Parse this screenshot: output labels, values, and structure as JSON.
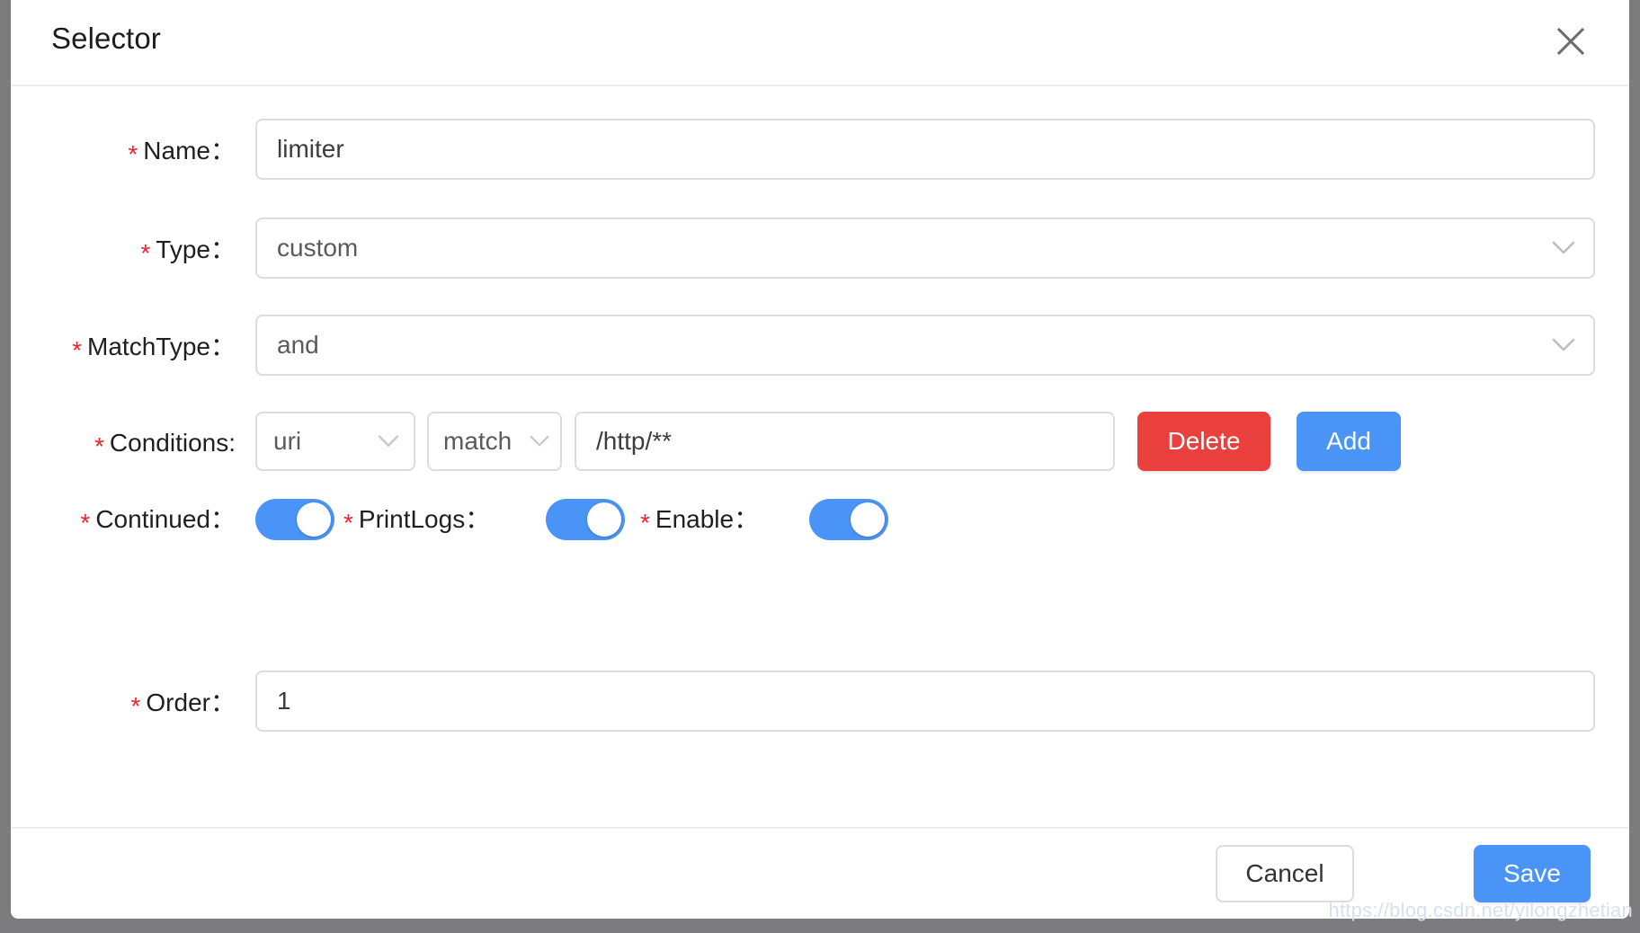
{
  "dialog": {
    "title": "Selector",
    "close_icon": "close-icon"
  },
  "form": {
    "name": {
      "label": "Name",
      "required_marker": "*",
      "colon": "：",
      "value": "limiter"
    },
    "type": {
      "label": "Type",
      "required_marker": "*",
      "colon": "：",
      "value": "custom",
      "dropdown_icon": "chevron-down-icon"
    },
    "match_type": {
      "label": "MatchType",
      "required_marker": "*",
      "colon": "：",
      "value": "and",
      "dropdown_icon": "chevron-down-icon"
    },
    "conditions": {
      "label": "Conditions:",
      "required_marker": "*",
      "rows": [
        {
          "param_type": "uri",
          "operator": "match",
          "value": "/http/**"
        }
      ],
      "delete_label": "Delete",
      "add_label": "Add"
    },
    "continued": {
      "label": "Continued",
      "required_marker": "*",
      "colon": "：",
      "checked": true
    },
    "print_logs": {
      "label": "PrintLogs",
      "required_marker": "*",
      "colon": "：",
      "checked": true
    },
    "enable": {
      "label": "Enable",
      "required_marker": "*",
      "colon": "：",
      "checked": true
    },
    "order": {
      "label": "Order",
      "required_marker": "*",
      "colon": "：",
      "value": "1"
    }
  },
  "footer": {
    "cancel_label": "Cancel",
    "save_label": "Save"
  },
  "watermark": {
    "text": "https://blog.csdn.net/yilongzhetian"
  },
  "colors": {
    "primary": "#4a94f8",
    "danger": "#e9403d",
    "required": "#f5222d",
    "overlay": "#7c7c7e",
    "border": "#dcdcdc"
  }
}
